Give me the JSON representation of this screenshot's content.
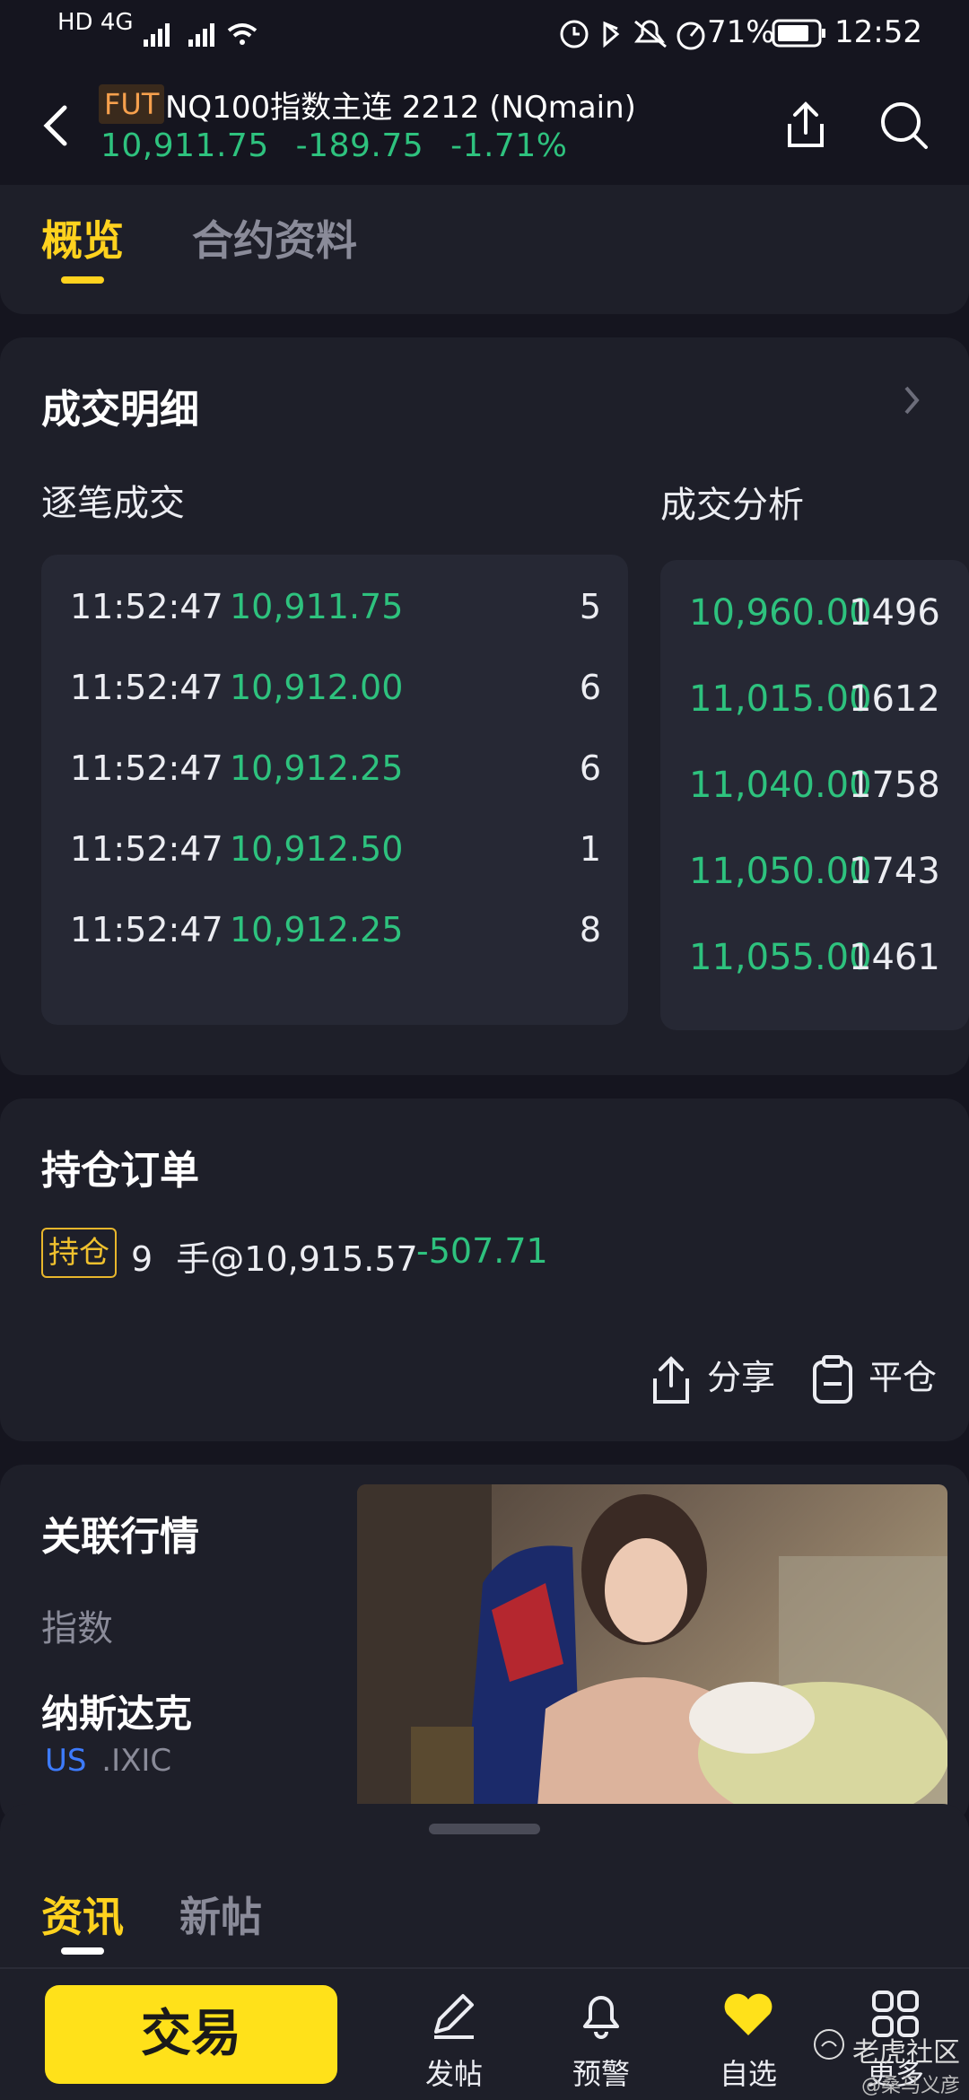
{
  "status_bar": {
    "signal": "HD 4G",
    "battery": "71%",
    "time": "12:52"
  },
  "header": {
    "badge": "FUT",
    "title": "NQ100指数主连 2212 (NQmain)",
    "price": "10,911.75",
    "change": "-189.75",
    "change_pct": "-1.71%",
    "up_color": "#2ec27e"
  },
  "tabs": [
    {
      "label": "概览",
      "active": true
    },
    {
      "label": "合约资料",
      "active": false
    }
  ],
  "trade_detail": {
    "title": "成交明细",
    "ticks_label": "逐笔成交",
    "analysis_label": "成交分析",
    "ticks": [
      {
        "time": "11:52:47",
        "price": "10,911.75",
        "volume": "5"
      },
      {
        "time": "11:52:47",
        "price": "10,912.00",
        "volume": "6"
      },
      {
        "time": "11:52:47",
        "price": "10,912.25",
        "volume": "6"
      },
      {
        "time": "11:52:47",
        "price": "10,912.50",
        "volume": "1"
      },
      {
        "time": "11:52:47",
        "price": "10,912.25",
        "volume": "8"
      }
    ],
    "analysis": [
      {
        "price": "10,960.00",
        "volume": "1496"
      },
      {
        "price": "11,015.00",
        "volume": "1612"
      },
      {
        "price": "11,040.00",
        "volume": "1758"
      },
      {
        "price": "11,050.00",
        "volume": "1743"
      },
      {
        "price": "11,055.00",
        "volume": "1461"
      }
    ]
  },
  "positions": {
    "title": "持仓订单",
    "badge": "持仓",
    "qty": "9",
    "unit": "手@",
    "avg_price": "10,915.57",
    "pnl": "-507.71",
    "share_label": "分享",
    "close_label": "平仓"
  },
  "related": {
    "title": "关联行情",
    "category": "指数",
    "name": "纳斯达克",
    "market": "US",
    "symbol": ".IXIC"
  },
  "sheet": {
    "tabs": [
      {
        "label": "资讯",
        "active": true
      },
      {
        "label": "新帖",
        "active": false
      }
    ]
  },
  "bottom_nav": {
    "trade_label": "交易",
    "items": [
      {
        "label": "发帖",
        "icon": "pencil-icon"
      },
      {
        "label": "预警",
        "icon": "bell-icon"
      },
      {
        "label": "自选",
        "icon": "heart-icon"
      },
      {
        "label": "更多",
        "icon": "grid-icon"
      }
    ]
  },
  "watermark": {
    "text": "老虎社区",
    "sub": "@桑马义彦"
  }
}
